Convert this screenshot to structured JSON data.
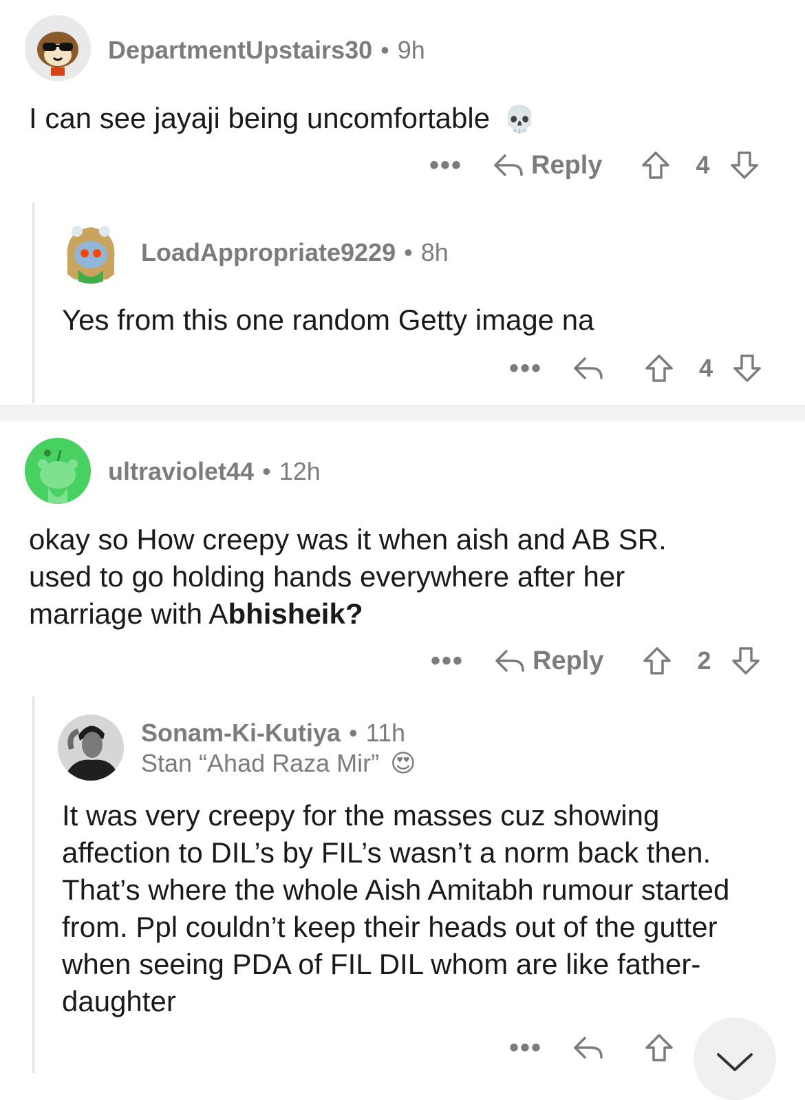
{
  "comments": [
    {
      "username": "DepartmentUpstairs30",
      "age": "9h",
      "body": "I can see jayaji being uncomfortable",
      "emoji": "💀",
      "more": "•••",
      "reply_label": "Reply",
      "score": "4"
    },
    {
      "username": "LoadAppropriate9229",
      "age": "8h",
      "body": "Yes from this one random Getty image na",
      "more": "•••",
      "score": "4"
    },
    {
      "username": "ultraviolet44",
      "age": "12h",
      "body_plain": "okay so How creepy was it when aish and AB SR. used to go holding hands everywhere after her marriage with A",
      "body_bold": "bhisheik?",
      "more": "•••",
      "reply_label": "Reply",
      "score": "2"
    },
    {
      "username": "Sonam-Ki-Kutiya",
      "age": "11h",
      "flair": "Stan “Ahad Raza Mir”",
      "flair_emoji": "😍",
      "body": "It was very creepy for the masses cuz showing affection to DIL’s by FIL’s wasn’t a norm back then. That’s where the whole Aish Amitabh rumour started from. Ppl couldn’t keep their heads out of the gutter when seeing PDA of FIL DIL whom are like father-daughter",
      "more": "•••"
    }
  ],
  "dot_separator": "•",
  "colors": {
    "meta_gray": "#7c7c7c",
    "text": "#1a1a1b",
    "thread_line": "#e4e4e4",
    "separator": "#f2f2f2",
    "avatar3_green": "#46d160"
  },
  "icons": [
    "reply-arrow-icon",
    "upvote-arrow-icon",
    "downvote-arrow-icon",
    "chevron-down-icon",
    "skull-emoji",
    "heart-eyes-emoji"
  ]
}
